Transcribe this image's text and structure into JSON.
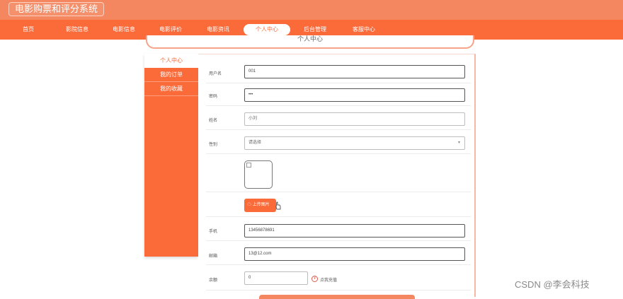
{
  "app": {
    "title": "电影购票和评分系统"
  },
  "nav": {
    "items": [
      {
        "label": "首页"
      },
      {
        "label": "影院信息"
      },
      {
        "label": "电影信息"
      },
      {
        "label": "电影评价"
      },
      {
        "label": "电影资讯"
      },
      {
        "label": "个人中心"
      },
      {
        "label": "后台管理"
      },
      {
        "label": "客服中心"
      }
    ],
    "active_index": 5
  },
  "banner": {
    "text": "个人中心"
  },
  "sidebar": {
    "items": [
      {
        "label": "个人中心"
      },
      {
        "label": "我的订单"
      },
      {
        "label": "我的收藏"
      }
    ]
  },
  "form": {
    "username": {
      "label": "用户名",
      "value": "001"
    },
    "password": {
      "label": "密码",
      "value": "•••"
    },
    "name": {
      "label": "姓名",
      "value": "小刘"
    },
    "gender": {
      "label": "性别",
      "value": "请选择"
    },
    "upload": {
      "label": "上传图片"
    },
    "phone": {
      "label": "手机",
      "value": "13456878691"
    },
    "email": {
      "label": "邮箱",
      "value": "13@12.com"
    },
    "balance": {
      "label": "余额",
      "value": "0",
      "recharge_label": "点我充值"
    }
  },
  "watermark": "CSDN @李会科技",
  "colors": {
    "accent": "#fb6a39",
    "topbar": "#f4875f"
  }
}
